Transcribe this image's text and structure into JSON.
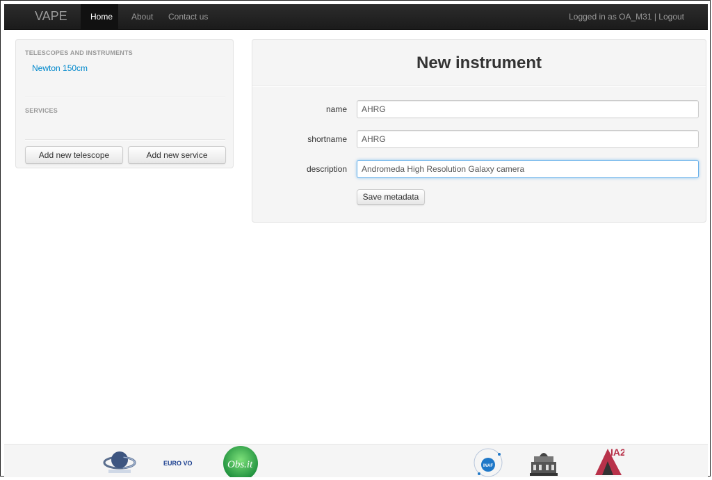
{
  "navbar": {
    "brand": "VAPE",
    "items": [
      {
        "label": "Home"
      },
      {
        "label": "About"
      },
      {
        "label": "Contact us"
      }
    ],
    "user_text": "Logged in as OA_M31 | Logout"
  },
  "sidebar": {
    "header_telescopes": "TELESCOPES AND INSTRUMENTS",
    "telescope_link": "Newton 150cm",
    "header_services": "SERVICES",
    "add_telescope_label": "Add new telescope",
    "add_service_label": "Add new service"
  },
  "form": {
    "title": "New instrument",
    "fields": [
      {
        "label": "name",
        "value": "AHRG"
      },
      {
        "label": "shortname",
        "value": "AHRG"
      },
      {
        "label": "description",
        "value": "Andromeda High Resolution Galaxy camera"
      }
    ],
    "save_label": "Save metadata"
  },
  "footer": {
    "logos": [
      "planet-logo",
      "euro-vo-logo",
      "obs-it-logo",
      "inaf-logo",
      "observatory-building-logo",
      "ia2-logo"
    ],
    "euro_vo_text": "EURO VO",
    "obs_text": "Obs.it",
    "inaf_text": "INAF",
    "ia2_text": "IA2"
  },
  "colors": {
    "navbar_bg": "#1b1b1b",
    "link": "#0088cc",
    "panel_bg": "#f5f5f5",
    "focus_border": "#66afe9"
  }
}
